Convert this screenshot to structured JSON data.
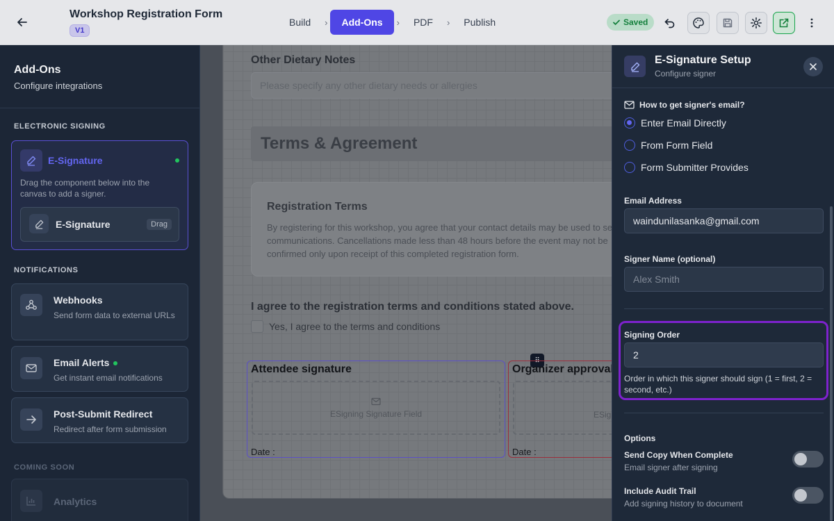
{
  "header": {
    "title": "Workshop Registration Form",
    "version": "V1",
    "steps": [
      "Build",
      "Add-Ons",
      "PDF",
      "Publish"
    ],
    "active_step": "Add-Ons",
    "saved_label": "Saved"
  },
  "sidebar": {
    "title": "Add-Ons",
    "subtitle": "Configure integrations",
    "sections": {
      "electronic_signing": "ELECTRONIC SIGNING",
      "notifications": "NOTIFICATIONS",
      "coming_soon": "COMING SOON"
    },
    "esignature": {
      "title": "E-Signature",
      "description": "Drag the component below into the canvas to add a signer.",
      "drag_item": "E-Signature",
      "drag_badge": "Drag"
    },
    "webhooks": {
      "title": "Webhooks",
      "description": "Send form data to external URLs"
    },
    "email_alerts": {
      "title": "Email Alerts",
      "description": "Get instant email notifications"
    },
    "redirect": {
      "title": "Post-Submit Redirect",
      "description": "Redirect after form submission"
    },
    "analytics": {
      "title": "Analytics"
    }
  },
  "canvas": {
    "dietary_label": "Other Dietary Notes",
    "dietary_placeholder": "Please specify any other dietary needs or allergies",
    "section_title": "Terms & Agreement",
    "terms_title": "Registration Terms",
    "terms_lines": [
      "By registering for this workshop, you agree that your contact details may be used to se",
      "communications. Cancellations made less than 48 hours before the event may not be",
      "confirmed only upon receipt of this completed registration form."
    ],
    "agree_question": "I agree to the registration terms and conditions stated above.",
    "agree_option": "Yes, I agree to the terms and conditions",
    "signatures": [
      {
        "title": "Attendee signature",
        "field": "ESigning Signature Field",
        "date": "Date   :"
      },
      {
        "title": "Organizer approval",
        "field": "ESig",
        "date": "Date   :"
      }
    ]
  },
  "panel": {
    "title": "E-Signature Setup",
    "subtitle": "Configure signer",
    "email_question": "How to get signer's email?",
    "email_options": [
      "Enter Email Directly",
      "From Form Field",
      "Form Submitter Provides"
    ],
    "email_selected": "Enter Email Directly",
    "email_label": "Email Address",
    "email_value": "waindunilasanka@gmail.com",
    "name_label": "Signer Name (optional)",
    "name_placeholder": "Alex Smith",
    "order_label": "Signing Order",
    "order_value": "2",
    "order_hint": "Order in which this signer should sign (1 = first, 2 = second, etc.)",
    "options_title": "Options",
    "options": [
      {
        "title": "Send Copy When Complete",
        "description": "Email signer after signing",
        "enabled": false
      },
      {
        "title": "Include Audit Trail",
        "description": "Add signing history to document",
        "enabled": false
      }
    ]
  },
  "colors": {
    "accent": "#4f46e5",
    "highlight": "#7e22ce",
    "success": "#22c55e"
  }
}
